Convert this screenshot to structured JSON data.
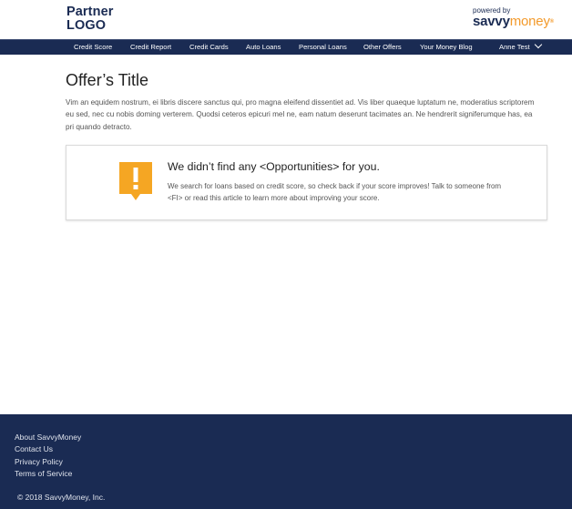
{
  "header": {
    "partner_logo_line1": "Partner",
    "partner_logo_line2": "LOGO",
    "powered_by": "powered by",
    "brand_savvy": "savvy",
    "brand_money": "money",
    "brand_mark": "®"
  },
  "nav": {
    "items": [
      {
        "label": "Credit Score"
      },
      {
        "label": "Credit Report"
      },
      {
        "label": "Credit Cards"
      },
      {
        "label": "Auto Loans"
      },
      {
        "label": "Personal Loans"
      },
      {
        "label": "Other Offers"
      },
      {
        "label": "Your Money Blog"
      }
    ],
    "user_name": "Anne Test"
  },
  "main": {
    "title": "Offer’s Title",
    "description": "Vim an equidem nostrum, ei libris discere sanctus qui, pro magna eleifend dissentiet ad. Vis liber quaeque luptatum ne, moderatius scriptorem eu sed, nec cu nobis doming verterem. Quodsi ceteros epicuri mel ne, eam natum deserunt tacimates an. Ne hendrerit signiferumque has, ea pri quando detracto.",
    "card": {
      "heading": "We didn’t find any <Opportunities> for you.",
      "text": "We search for loans based on credit score, so check back if your score improves! Talk to someone from <FI> or read this article to learn more about improving your score."
    }
  },
  "footer": {
    "links": [
      {
        "label": "About SavvyMoney"
      },
      {
        "label": "Contact Us"
      },
      {
        "label": "Privacy Policy"
      },
      {
        "label": "Terms of Service"
      }
    ],
    "copyright": "© 2018 SavvyMoney, Inc."
  },
  "colors": {
    "navy": "#1a2b53",
    "accent_orange": "#f39a2b",
    "alert_orange": "#f5a623"
  },
  "icons": {
    "alert": "alert-exclamation-icon",
    "dropdown": "chevron-down-icon"
  }
}
